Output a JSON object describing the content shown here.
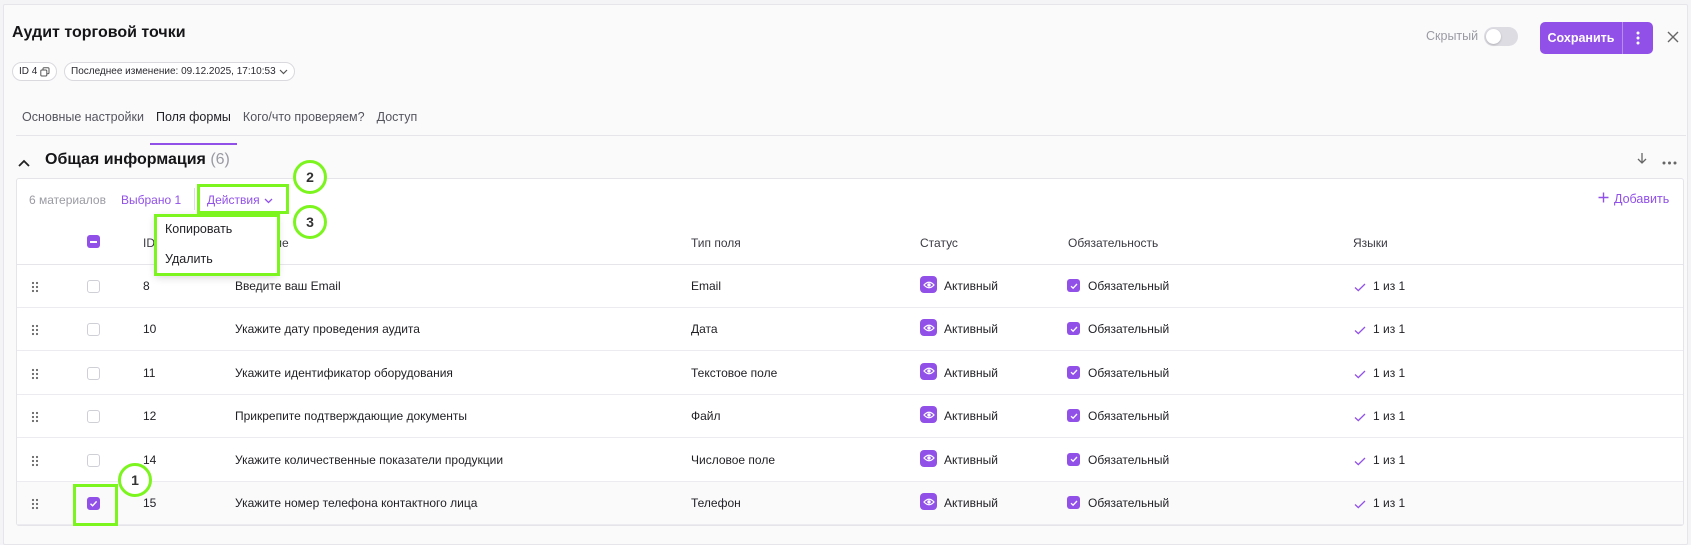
{
  "header": {
    "title": "Аудит торговой точки",
    "id_chip": "ID 4",
    "last_change_chip": "Последнее изменение: 09.12.2025, 17:10:53",
    "hidden_label": "Скрытый",
    "hidden_toggle_on": false,
    "save_label": "Сохранить"
  },
  "tabs": [
    {
      "label": "Основные настройки",
      "active": false
    },
    {
      "label": "Поля формы",
      "active": true
    },
    {
      "label": "Кого/что проверяем?",
      "active": false
    },
    {
      "label": "Доступ",
      "active": false
    }
  ],
  "section": {
    "title": "Общая информация",
    "count": "(6)"
  },
  "toolbar": {
    "materials_count": "6 материалов",
    "selected": "Выбрано 1",
    "actions_label": "Действия",
    "add_label": "Добавить"
  },
  "dropdown": {
    "items": [
      "Копировать",
      "Удалить"
    ]
  },
  "table": {
    "columns": [
      "ID",
      "Название",
      "Тип поля",
      "Статус",
      "Обязательность",
      "Языки"
    ],
    "rows": [
      {
        "id": "8",
        "name": "Введите ваш Email",
        "type": "Email",
        "status": "Активный",
        "required": "Обязательный",
        "langs": "1 из 1",
        "checked": false
      },
      {
        "id": "10",
        "name": "Укажите дату проведения аудита",
        "type": "Дата",
        "status": "Активный",
        "required": "Обязательный",
        "langs": "1 из 1",
        "checked": false
      },
      {
        "id": "11",
        "name": "Укажите идентификатор оборудования",
        "type": "Текстовое поле",
        "status": "Активный",
        "required": "Обязательный",
        "langs": "1 из 1",
        "checked": false
      },
      {
        "id": "12",
        "name": "Прикрепите подтверждающие документы",
        "type": "Файл",
        "status": "Активный",
        "required": "Обязательный",
        "langs": "1 из 1",
        "checked": false
      },
      {
        "id": "14",
        "name": "Укажите количественные показатели продукции",
        "type": "Числовое поле",
        "status": "Активный",
        "required": "Обязательный",
        "langs": "1 из 1",
        "checked": false
      },
      {
        "id": "15",
        "name": "Укажите номер телефона контактного лица",
        "type": "Телефон",
        "status": "Активный",
        "required": "Обязательный",
        "langs": "1 из 1",
        "checked": true
      }
    ]
  },
  "annotations": [
    "1",
    "2",
    "3"
  ],
  "colors": {
    "accent": "#9150e8",
    "highlight": "#7cf51e"
  }
}
